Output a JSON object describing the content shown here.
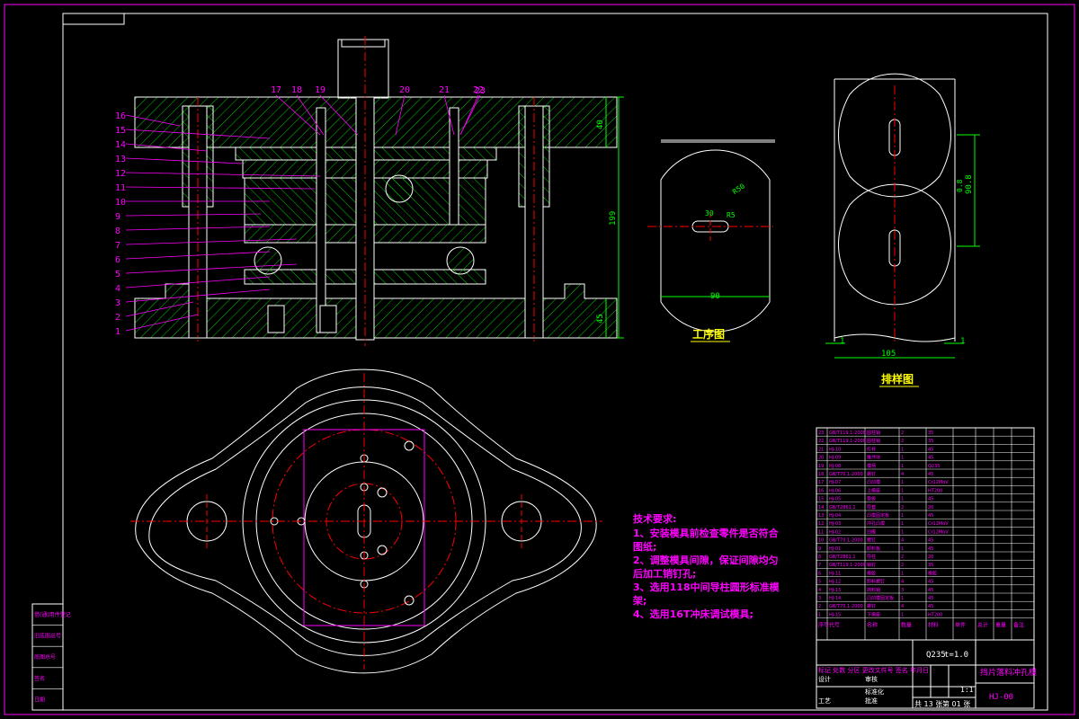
{
  "title_block": {
    "drawing_title": "挡片落料冲孔模",
    "drawing_number": "HJ-00",
    "material": "Q235",
    "thickness": "t=1.0",
    "scale": "1:1",
    "sheet_total": "共 13 张",
    "sheet_no": "第 01 张",
    "approval_labels": [
      "标记",
      "处数",
      "分区",
      "更改文件号",
      "签名",
      "年月日"
    ],
    "role_labels": [
      "设计",
      "审核",
      "工艺",
      "标准化",
      "批准"
    ],
    "column_headers": [
      "序号",
      "代号",
      "名称",
      "数量",
      "材料",
      "单件",
      "总计",
      "重量",
      "备注"
    ]
  },
  "parts_list": [
    {
      "no": "23",
      "code": "GB/T119.1-2000",
      "name": "圆柱销",
      "qty": "2",
      "mat": "35"
    },
    {
      "no": "22",
      "code": "GB/T119.1-2000",
      "name": "圆柱销",
      "qty": "2",
      "mat": "35"
    },
    {
      "no": "21",
      "code": "HJ-10",
      "name": "打杆",
      "qty": "1",
      "mat": "45"
    },
    {
      "no": "20",
      "code": "HJ-09",
      "name": "推件块",
      "qty": "1",
      "mat": "45"
    },
    {
      "no": "19",
      "code": "HJ-08",
      "name": "模柄",
      "qty": "1",
      "mat": "Q235"
    },
    {
      "no": "18",
      "code": "GB/T70.1-2000",
      "name": "螺钉",
      "qty": "4",
      "mat": "45"
    },
    {
      "no": "17",
      "code": "HJ-07",
      "name": "凸凹模",
      "qty": "1",
      "mat": "Cr12MoV"
    },
    {
      "no": "16",
      "code": "HJ-06",
      "name": "上模座",
      "qty": "1",
      "mat": "HT200"
    },
    {
      "no": "15",
      "code": "HJ-05",
      "name": "垫板",
      "qty": "1",
      "mat": "45"
    },
    {
      "no": "14",
      "code": "GB/T2861.1",
      "name": "导套",
      "qty": "2",
      "mat": "20"
    },
    {
      "no": "13",
      "code": "HJ-04",
      "name": "凸模固定板",
      "qty": "1",
      "mat": "45"
    },
    {
      "no": "12",
      "code": "HJ-03",
      "name": "冲孔凸模",
      "qty": "1",
      "mat": "Cr12MoV"
    },
    {
      "no": "11",
      "code": "HJ-02",
      "name": "凹模",
      "qty": "1",
      "mat": "Cr12MoV"
    },
    {
      "no": "10",
      "code": "GB/T70.1-2000",
      "name": "螺钉",
      "qty": "4",
      "mat": "45"
    },
    {
      "no": "9",
      "code": "HJ-01",
      "name": "卸料板",
      "qty": "1",
      "mat": "45"
    },
    {
      "no": "8",
      "code": "GB/T2861.1",
      "name": "导柱",
      "qty": "2",
      "mat": "20"
    },
    {
      "no": "7",
      "code": "GB/T119.1-2000",
      "name": "销钉",
      "qty": "2",
      "mat": "35"
    },
    {
      "no": "6",
      "code": "HJ-11",
      "name": "橡胶",
      "qty": "1",
      "mat": "橡胶"
    },
    {
      "no": "5",
      "code": "HJ-12",
      "name": "卸料螺钉",
      "qty": "4",
      "mat": "45"
    },
    {
      "no": "4",
      "code": "HJ-13",
      "name": "挡料销",
      "qty": "3",
      "mat": "45"
    },
    {
      "no": "3",
      "code": "HJ-14",
      "name": "凸凹模固定板",
      "qty": "1",
      "mat": "45"
    },
    {
      "no": "2",
      "code": "GB/T70.1-2000",
      "name": "螺钉",
      "qty": "4",
      "mat": "45"
    },
    {
      "no": "1",
      "code": "HJ-15",
      "name": "下模座",
      "qty": "1",
      "mat": "HT200"
    }
  ],
  "tech_requirements": {
    "heading": "技术要求:",
    "lines": [
      "1、安装模具前检查零件是否符合",
      "图纸;",
      "2、调整模具间隙，保证间隙均匀",
      "后加工销钉孔;",
      "3、选用118中间导柱圆形标准模",
      "架;",
      "4、选用16T冲床调试模具;"
    ]
  },
  "views": {
    "process_view_title": "工序图",
    "layout_view_title": "排样图"
  },
  "part_callouts": [
    "1",
    "2",
    "3",
    "4",
    "5",
    "6",
    "7",
    "8",
    "9",
    "10",
    "11",
    "12",
    "13",
    "14",
    "15",
    "16"
  ],
  "top_callouts": [
    "17",
    "18",
    "19",
    "20",
    "21",
    "22",
    "23"
  ],
  "dimensions": {
    "height_total": "199",
    "upper_plate": "40",
    "lower_plate": "45",
    "part_width": "90",
    "slot_len": "30",
    "slot_w": "R5",
    "radius": "R50",
    "strip_width": "105",
    "pitch": "90.8",
    "gap": "1",
    "pitch_small": "0.8"
  },
  "left_stamp": [
    "借(通)用件登记",
    "旧底图总号",
    "底图总号",
    "签名",
    "日期"
  ],
  "colors": {
    "outline": "#ffffff",
    "callout": "#ff00ff",
    "hatch": "#00ff00",
    "centerline": "#ff0000",
    "frame": "#ff00ff",
    "dimension": "#00ff00",
    "text_yellow": "#ffff00"
  }
}
